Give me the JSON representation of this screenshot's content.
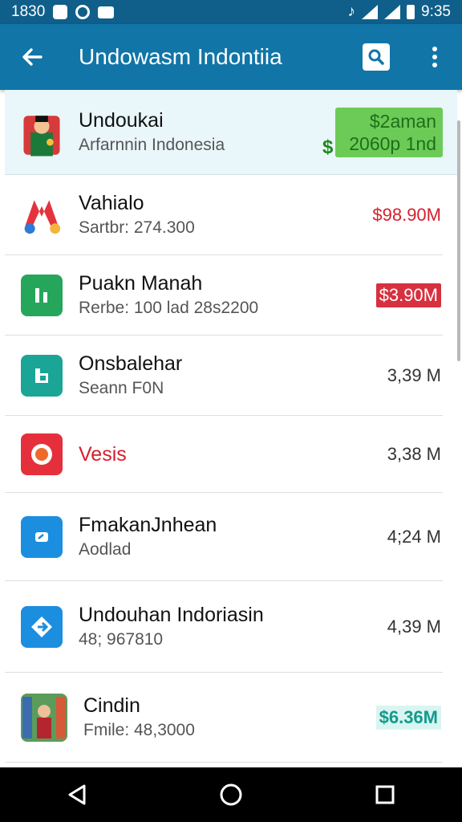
{
  "status": {
    "time_left": "1830",
    "time_right": "9:35"
  },
  "appbar": {
    "title": "Undowasm Indontiia",
    "back_icon": "back-arrow-icon",
    "search_icon": "search-icon",
    "more_icon": "more-vert-icon"
  },
  "featured": {
    "name": "Undoukai",
    "subtitle": "Arfarnnin Indonesia",
    "price_line1": "$2aman",
    "price_line2": "2060p 1nd",
    "dollar": "$"
  },
  "items": [
    {
      "name": "Vahialo",
      "subtitle": "Sartbr: 274.300",
      "price": "$98.90M",
      "style": "redtext"
    },
    {
      "name": "Puakn Manah",
      "subtitle": "Rerbe: 100 lad 28s2200",
      "price": "$3.90M",
      "style": "red"
    },
    {
      "name": "Onsbalehar",
      "subtitle": "Seann F0N",
      "price": "3,39 M",
      "style": "plain"
    },
    {
      "name": "Vesis",
      "subtitle": "",
      "price": "3,38 M",
      "style": "plain"
    },
    {
      "name": "FmakanJnhean",
      "subtitle": "Aodlad",
      "price": "4;24 M",
      "style": "plain"
    },
    {
      "name": "Undouhan Indoriasin",
      "subtitle": "48; 967810",
      "price": "4,39 M",
      "style": "plain"
    },
    {
      "name": "Cindin",
      "subtitle": "Fmile: 48,3000",
      "price": "$6.36M",
      "style": "teal"
    }
  ],
  "colors": {
    "appbar": "#1175a8",
    "statusbar": "#0f5f8a",
    "accent_red": "#d6313f",
    "accent_green": "#6ccb57"
  }
}
